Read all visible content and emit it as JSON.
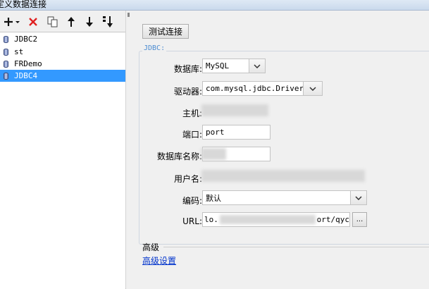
{
  "window": {
    "title": "定义数据连接"
  },
  "toolbar": {
    "add_icon": "plus-icon",
    "delete_icon": "red-x-icon",
    "copy_icon": "copy-icon",
    "up_icon": "arrow-up-icon",
    "down_icon": "arrow-down-icon",
    "sort_icon": "sort-down-icon"
  },
  "connections": [
    {
      "label": "JDBC2",
      "selected": false
    },
    {
      "label": "st",
      "selected": false
    },
    {
      "label": "FRDemo",
      "selected": false
    },
    {
      "label": "JDBC4",
      "selected": true
    }
  ],
  "test_button": "测试连接",
  "jdbc": {
    "group_title": "JDBC:",
    "database_label": "数据库:",
    "database_value": "MySQL",
    "driver_label": "驱动器:",
    "driver_value": "com.mysql.jdbc.Driver",
    "host_label": "主机:",
    "host_value": "",
    "port_label": "端口:",
    "port_value": "port",
    "dbname_label": "数据库名称:",
    "dbname_value": "",
    "username_label": "用户名:",
    "username_value": "",
    "encoding_label": "编码:",
    "encoding_value": "默认",
    "url_label": "URL:",
    "url_prefix": "lo.",
    "url_suffix": "ort/qyc",
    "url_button": "..."
  },
  "advanced": {
    "title": "高级",
    "link": "高级设置"
  }
}
